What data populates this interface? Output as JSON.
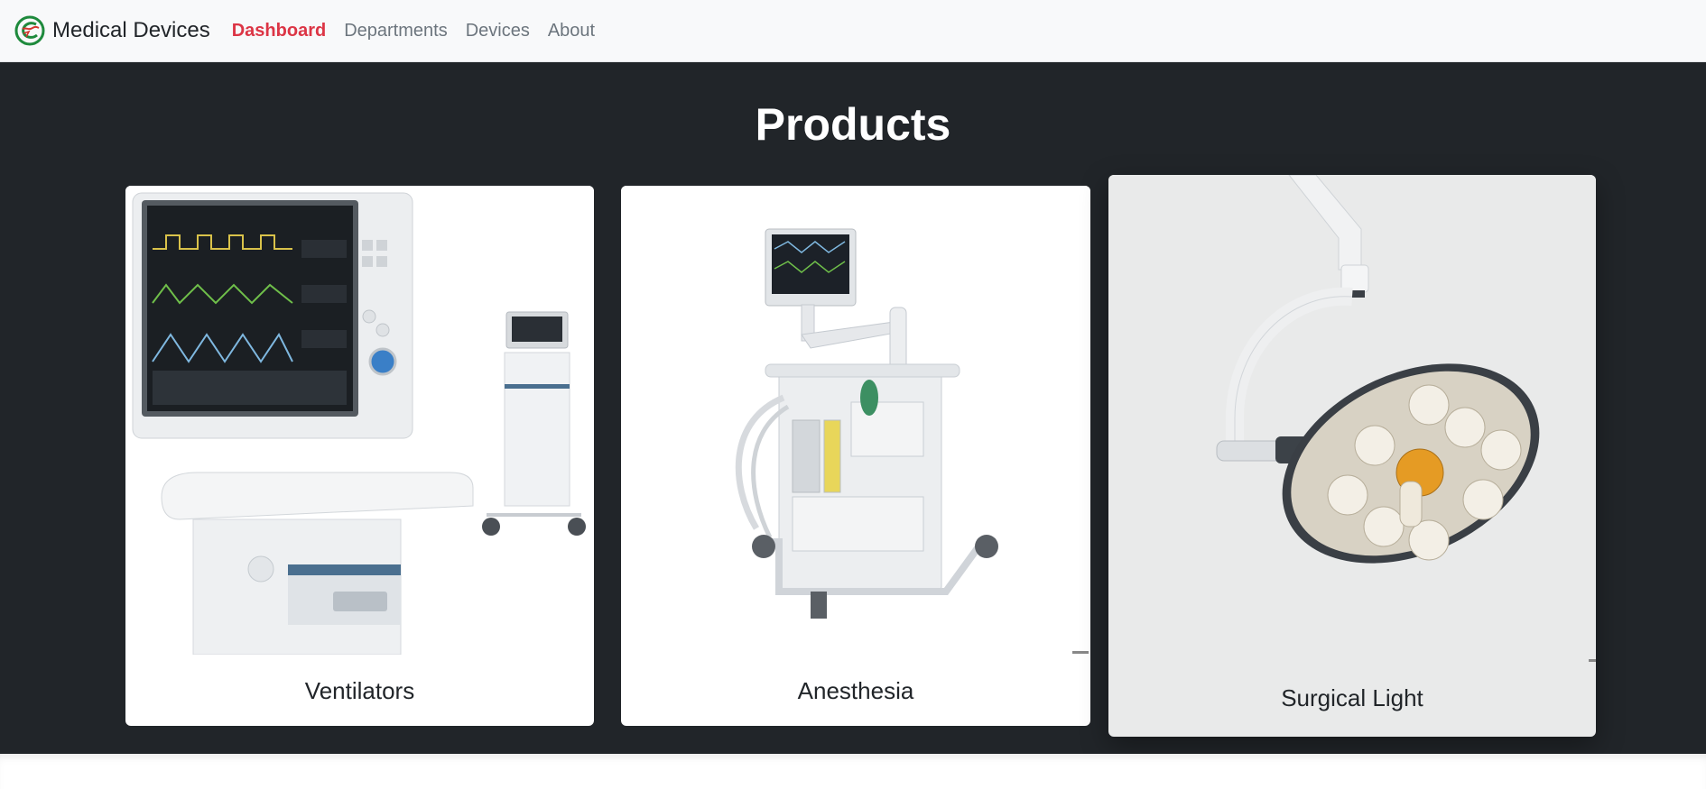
{
  "brand": {
    "name": "Medical Devices"
  },
  "nav": {
    "items": [
      {
        "label": "Dashboard",
        "active": true
      },
      {
        "label": "Departments",
        "active": false
      },
      {
        "label": "Devices",
        "active": false
      },
      {
        "label": "About",
        "active": false
      }
    ]
  },
  "products": {
    "title": "Products",
    "cards": [
      {
        "title": "Ventilators"
      },
      {
        "title": "Anesthesia"
      },
      {
        "title": "Surgical Light"
      }
    ]
  },
  "colors": {
    "active_link": "#dc3545",
    "dark_section": "#212529",
    "logo_green": "#1e8a3c",
    "logo_red": "#d4342c"
  }
}
